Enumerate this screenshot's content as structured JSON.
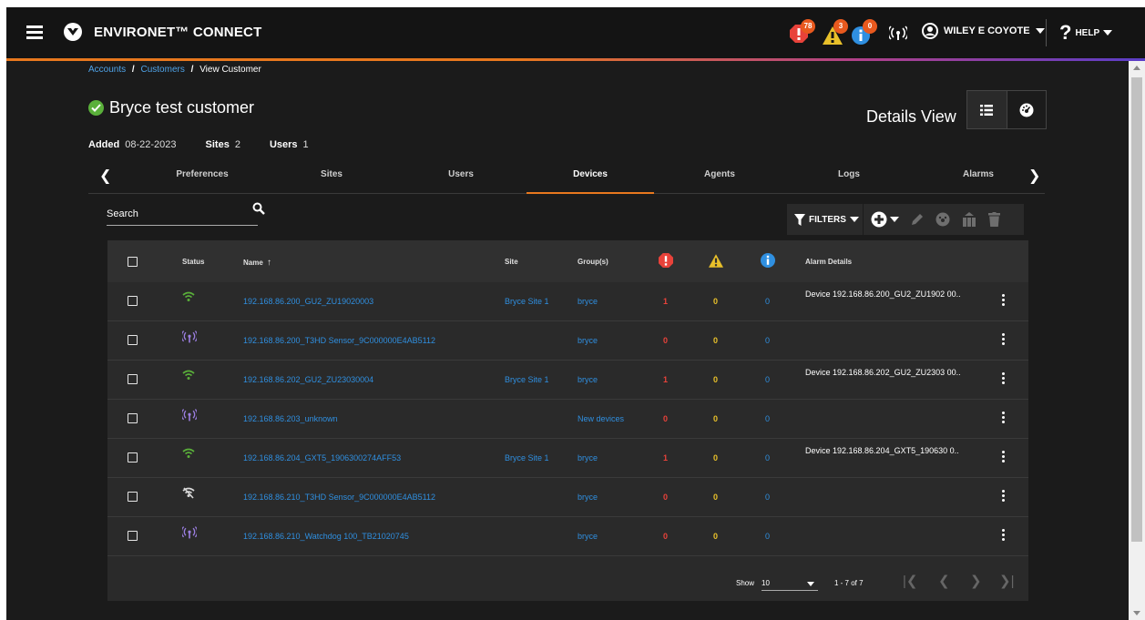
{
  "app": {
    "title": "ENVIRONET™ CONNECT"
  },
  "header": {
    "notifications": [
      {
        "name": "critical",
        "count": "78",
        "color": "#e8423a"
      },
      {
        "name": "warning",
        "count": "3",
        "color": "#e8c02a"
      },
      {
        "name": "info",
        "count": "0",
        "color": "#2f8fe0"
      }
    ],
    "user": "WILEY E COYOTE",
    "help": "HELP"
  },
  "breadcrumb": [
    "Accounts",
    "Customers",
    "View Customer"
  ],
  "customer": {
    "name": "Bryce test customer",
    "added_label": "Added",
    "added": "08-22-2023",
    "sites_label": "Sites",
    "sites": "2",
    "users_label": "Users",
    "users": "1"
  },
  "details_view": "Details View",
  "tabs": [
    "Preferences",
    "Sites",
    "Users",
    "Devices",
    "Agents",
    "Logs",
    "Alarms"
  ],
  "active_tab": "Devices",
  "search": {
    "label": "Search"
  },
  "toolbar": {
    "filters": "FILTERS"
  },
  "table": {
    "columns": {
      "status": "Status",
      "name": "Name",
      "site": "Site",
      "groups": "Group(s)",
      "alarm_details": "Alarm Details"
    },
    "rows": [
      {
        "status": "wifi",
        "name": "192.168.86.200_GU2_ZU19020003",
        "site": "Bryce Site 1",
        "group": "bryce",
        "crit": "1",
        "warn": "0",
        "info": "0",
        "details": "Device 192.168.86.200_GU2_ZU1902 00.."
      },
      {
        "status": "radio",
        "name": "192.168.86.200_T3HD Sensor_9C000000E4AB5112",
        "site": "",
        "group": "bryce",
        "crit": "0",
        "warn": "0",
        "info": "0",
        "details": ""
      },
      {
        "status": "wifi",
        "name": "192.168.86.202_GU2_ZU23030004",
        "site": "Bryce Site 1",
        "group": "bryce",
        "crit": "1",
        "warn": "0",
        "info": "0",
        "details": "Device 192.168.86.202_GU2_ZU2303 00.."
      },
      {
        "status": "radio",
        "name": "192.168.86.203_unknown",
        "site": "",
        "group": "New devices",
        "crit": "0",
        "warn": "0",
        "info": "0",
        "details": ""
      },
      {
        "status": "wifi",
        "name": "192.168.86.204_GXT5_1906300274AFF53",
        "site": "Bryce Site 1",
        "group": "bryce",
        "crit": "1",
        "warn": "0",
        "info": "0",
        "details": "Device 192.168.86.204_GXT5_190630 0.."
      },
      {
        "status": "wifi-off",
        "name": "192.168.86.210_T3HD Sensor_9C000000E4AB5112",
        "site": "",
        "group": "bryce",
        "crit": "0",
        "warn": "0",
        "info": "0",
        "details": ""
      },
      {
        "status": "radio",
        "name": "192.168.86.210_Watchdog 100_TB21020745",
        "site": "",
        "group": "bryce",
        "crit": "0",
        "warn": "0",
        "info": "0",
        "details": ""
      }
    ]
  },
  "pager": {
    "show_label": "Show",
    "page_size": "10",
    "range": "1 - 7 of 7"
  },
  "colors": {
    "accent": "#e8781e",
    "link": "#2f8fe0",
    "ok": "#5ab03a",
    "wifi": "#5ab03a",
    "radio": "#9b7ee0"
  }
}
